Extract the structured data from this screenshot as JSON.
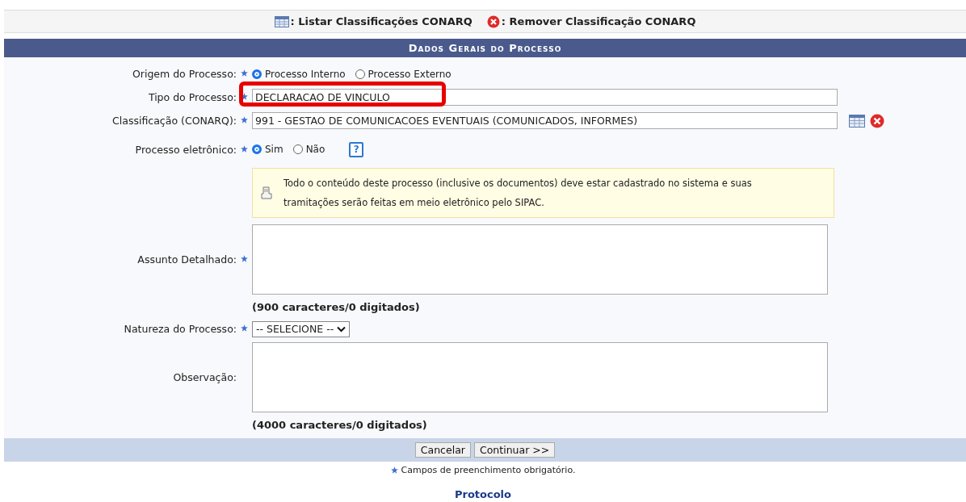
{
  "top_links": [
    {
      "kind": "list",
      "label": ": Listar Classificações CONARQ"
    },
    {
      "kind": "remove",
      "label": ": Remover Classificação CONARQ"
    }
  ],
  "section_title": "Dados Gerais do Processo",
  "rows": [
    {
      "kind": "radio",
      "label": "Origem do Processo:",
      "required": true,
      "options": [
        {
          "label": "Processo Interno",
          "selected": true
        },
        {
          "label": "Processo Externo",
          "selected": false
        }
      ]
    },
    {
      "kind": "text",
      "label": "Tipo do Processo:",
      "required": true,
      "value": "DECLARACAO DE VINCULO",
      "highlighted": true
    },
    {
      "kind": "text",
      "label": "Classificação (CONARQ):",
      "required": true,
      "value": "991 - GESTAO DE COMUNICACOES EVENTUAIS (COMUNICADOS, INFORMES)",
      "icons": true,
      "highlighted": false
    },
    {
      "kind": "radio",
      "label": "Processo eletrônico:",
      "required": true,
      "options": [
        {
          "label": "Sim",
          "selected": true
        },
        {
          "label": "Não",
          "selected": false
        }
      ],
      "help": "?"
    },
    {
      "kind": "info",
      "text": "Todo o conteúdo deste processo (inclusive os documentos) deve estar cadastrado no sistema e suas tramitações serão feitas em meio eletrônico pelo SIPAC."
    },
    {
      "kind": "textarea",
      "label": "Assunto Detalhado:",
      "required": true,
      "counter": "(900 caracteres/0 digitados)"
    },
    {
      "kind": "select",
      "label": "Natureza do Processo:",
      "required": true,
      "value": "-- SELECIONE --"
    },
    {
      "kind": "textarea",
      "label": "Observação:",
      "required": false,
      "counter": "(4000 caracteres/0 digitados)"
    }
  ],
  "buttons": [
    "Cancelar",
    "Continuar >>"
  ],
  "footnote": "Campos de preenchimento obrigatório.",
  "footer_link": "Protocolo"
}
